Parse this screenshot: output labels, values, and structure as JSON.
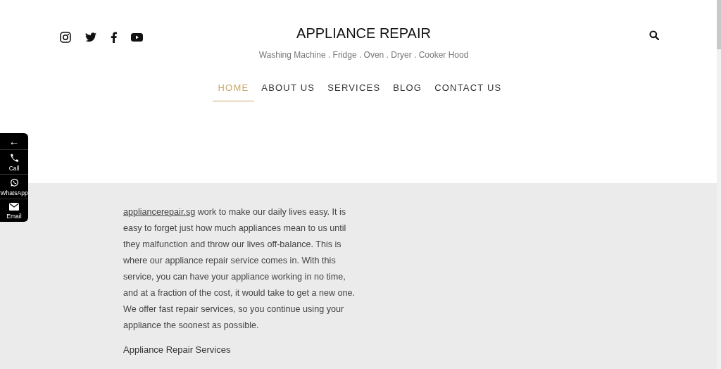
{
  "social": [
    {
      "kind": "instagram"
    },
    {
      "kind": "twitter"
    },
    {
      "kind": "facebook"
    },
    {
      "kind": "youtube"
    }
  ],
  "site": {
    "title": "APPLIANCE REPAIR",
    "tagline": "Washing Machine . Fridge . Oven . Dryer . Cooker Hood"
  },
  "nav": [
    {
      "label": "HOME",
      "selected": true
    },
    {
      "label": "ABOUT US",
      "selected": false
    },
    {
      "label": "SERVICES",
      "selected": false
    },
    {
      "label": "BLOG",
      "selected": false
    },
    {
      "label": "CONTACT US",
      "selected": false
    }
  ],
  "contact_bar": {
    "toggle": "←",
    "items": [
      {
        "kind": "call",
        "label": "Call"
      },
      {
        "kind": "whatsapp",
        "label": "WhatsApp"
      },
      {
        "kind": "email",
        "label": "Email"
      }
    ]
  },
  "content": {
    "link": "appliancerepair.sg",
    "text": " work to make our daily lives easy. It is easy to forget just how much appliances mean to us until they malfunction and throw our lives off-balance. This is where our appliance repair service comes in. With this service, you can have your appliance working in no time, and at a fraction of the cost, it would take to get a new one. We offer fast repair services, so you continue using your appliance the soonest as possible.",
    "heading": "Appliance Repair Services"
  }
}
